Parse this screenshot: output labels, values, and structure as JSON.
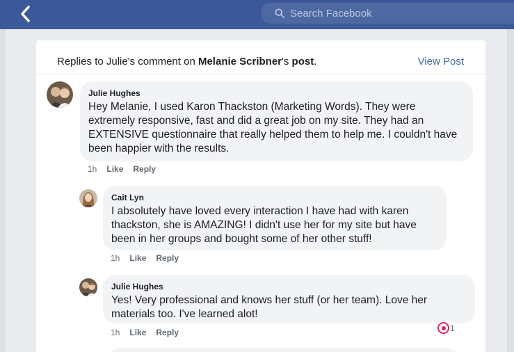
{
  "topbar": {
    "back_icon": "chevron-left-icon",
    "search_icon": "search-icon",
    "search_placeholder": "Search Facebook"
  },
  "card": {
    "header": {
      "prefix": "Replies to Julie's comment on ",
      "post_owner": "Melanie Scribner",
      "possessive": "'s ",
      "post_word": "post",
      "suffix": "."
    },
    "view_post_label": "View Post"
  },
  "comments": [
    {
      "author": "Julie Hughes",
      "text": "Hey Melanie, I used Karon Thackston (Marketing Words).  They were extremely responsive, fast and did a great job on my site. They had an EXTENSIVE questionnaire that really helped them to help me.  I couldn't have been happier with the results.",
      "time": "1h",
      "like": "Like",
      "reply": "Reply"
    },
    {
      "author": "Cait Lyn",
      "text": "I absolutely have loved every interaction I have had with karen thackston, she is AMAZING! I didn't use her for my site but have been in her groups and bought some of her other stuff!",
      "time": "1h",
      "like": "Like",
      "reply": "Reply"
    },
    {
      "author": "Julie Hughes",
      "text": "Yes!  Very professional and knows her stuff (or her team). Love her materials too.  I've learned alot!",
      "time": "1h",
      "like": "Like",
      "reply": "Reply",
      "reaction_icon": "heart-reaction-icon",
      "reaction_count": "1"
    }
  ],
  "colors": {
    "brand": "#3b5998",
    "link": "#4267b2",
    "bubble": "#f2f3f5",
    "love": "#e0245e"
  }
}
